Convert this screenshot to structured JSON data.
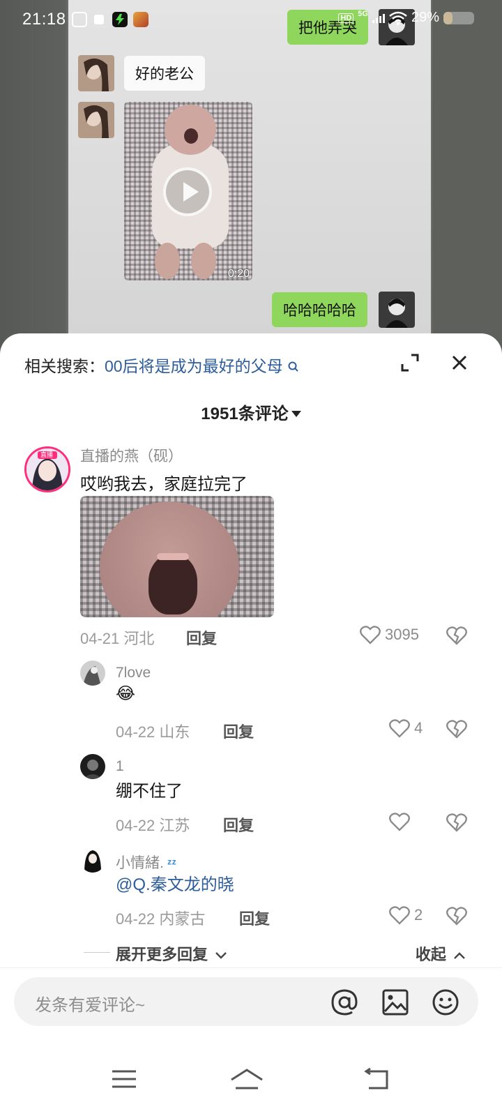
{
  "status_bar": {
    "time": "21:18",
    "hd_badge": "HD",
    "network": "5G",
    "battery": "29%",
    "battery_level": 0.29
  },
  "video_chat": {
    "messages": [
      {
        "side": "right",
        "text": "把他弄哭"
      },
      {
        "side": "left",
        "text": "好的老公"
      },
      {
        "side": "left",
        "type": "video",
        "duration": "0:20"
      },
      {
        "side": "right",
        "text": "哈哈哈哈哈"
      }
    ]
  },
  "comment_sheet": {
    "related_label": "相关搜索：",
    "related_query": "00后将是成为最好的父母",
    "count_title": "1951条评论"
  },
  "comments": [
    {
      "user": "直播的燕（砚）",
      "avatar_badge": "直播",
      "text": "哎哟我去，家庭拉完了",
      "date": "04-21",
      "location": "河北",
      "reply": "回复",
      "likes": "3095",
      "has_image": true
    },
    {
      "user": "7love",
      "text": "😂",
      "date": "04-22",
      "location": "山东",
      "reply": "回复",
      "likes": "4"
    },
    {
      "user": "1",
      "text": "绷不住了",
      "date": "04-22",
      "location": "江苏",
      "reply": "回复",
      "likes": ""
    },
    {
      "user": "小情緒.",
      "text": "@Q.秦文龙的晓",
      "date": "04-22",
      "location": "内蒙古",
      "reply": "回复",
      "likes": "2"
    }
  ],
  "thread_controls": {
    "expand_more": "展开更多回复",
    "collapse": "收起"
  },
  "input": {
    "placeholder": "发条有爱评论~"
  },
  "icons": {
    "search": "search-icon",
    "expand": "expand-icon",
    "close": "close-icon",
    "like": "heart-icon",
    "dislike": "broken-heart-icon",
    "at": "at-icon",
    "image": "image-icon",
    "emoji": "emoji-icon",
    "nav_menu": "menu-icon",
    "nav_home": "home-icon",
    "nav_back": "back-icon"
  },
  "colors": {
    "bubble_green": "#8fd65c",
    "link_blue": "#2d5d9a",
    "sheet_bg": "#ffffff"
  }
}
